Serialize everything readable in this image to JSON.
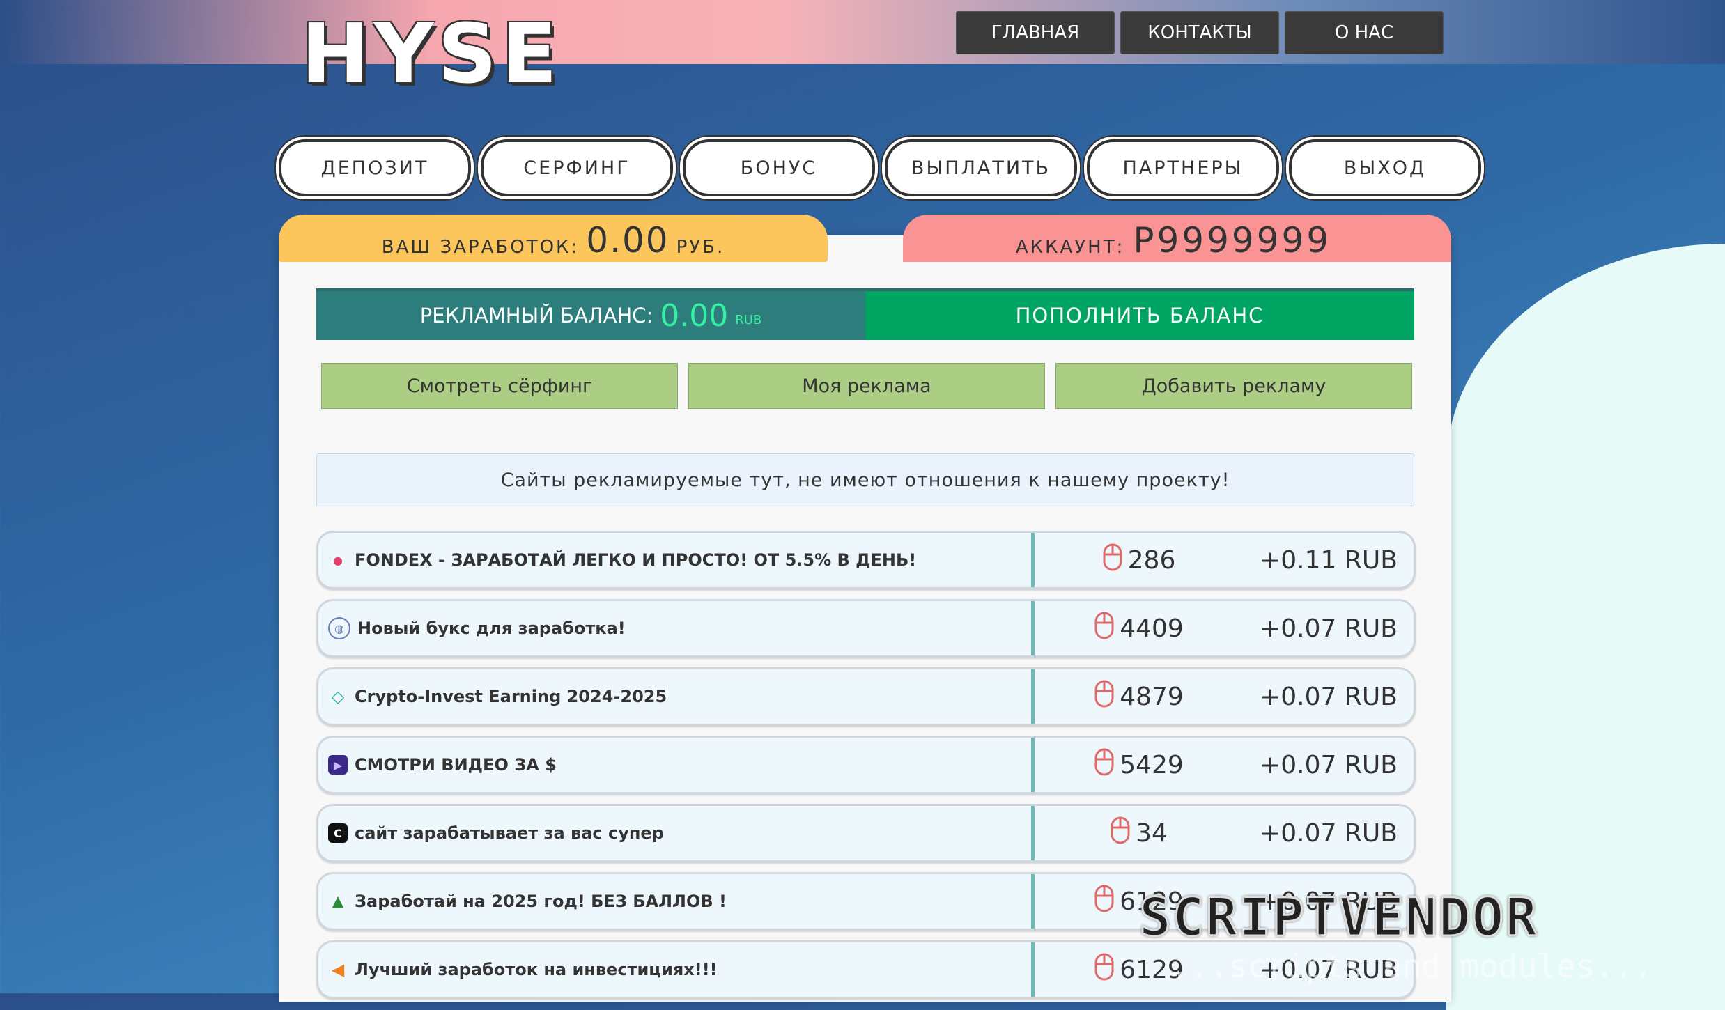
{
  "logo": "HYSE",
  "top_nav": [
    "ГЛАВНАЯ",
    "КОНТАКТЫ",
    "О НАС"
  ],
  "main_nav": [
    "ДЕПОЗИТ",
    "СЕРФИНГ",
    "БОНУС",
    "ВЫПЛАТИТЬ",
    "ПАРТНЕРЫ",
    "ВЫХОД"
  ],
  "earnings": {
    "label": "ВАШ ЗАРАБОТОК:",
    "value": "0.00",
    "currency": "РУБ."
  },
  "account": {
    "label": "АККАУНТ:",
    "value": "P9999999"
  },
  "ad_balance": {
    "label": "РЕКЛАМНЫЙ БАЛАНС:",
    "value": "0.00",
    "currency": "RUB",
    "topup": "ПОПОЛНИТЬ БАЛАНС"
  },
  "actions": [
    "Смотреть сёрфинг",
    "Моя реклама",
    "Добавить рекламу"
  ],
  "notice": "Сайты рекламируемые тут, не имеют отношения к нашему проекту!",
  "ads": [
    {
      "title": "FONDEX - ЗАРАБОТАЙ ЛЕГКО И ПРОСТО! ОТ 5.5% В ДЕНЬ!",
      "views": "286",
      "reward": "+0.11 RUB",
      "icon": "dot-icon"
    },
    {
      "title": "Новый букс для заработка!",
      "views": "4409",
      "reward": "+0.07 RUB",
      "icon": "globe-icon"
    },
    {
      "title": "Crypto-Invest Earning 2024-2025",
      "views": "4879",
      "reward": "+0.07 RUB",
      "icon": "diamond-icon"
    },
    {
      "title": "СМОТРИ ВИДЕО ЗА $",
      "views": "5429",
      "reward": "+0.07 RUB",
      "icon": "play-icon"
    },
    {
      "title": "сайт зарабатывает за вас супер",
      "views": "34",
      "reward": "+0.07 RUB",
      "icon": "c-logo-icon"
    },
    {
      "title": "Заработай на 2025 год! БЕЗ БАЛЛОВ !",
      "views": "6129",
      "reward": "+0.07 RUB",
      "icon": "tree-icon"
    },
    {
      "title": "Лучший заработок на инвестициях!!!",
      "views": "6129",
      "reward": "+0.07 RUB",
      "icon": "fish-icon"
    }
  ],
  "watermark": {
    "brand": "SCRIPTVENDOR",
    "tagline": "...scripts and modules..."
  }
}
